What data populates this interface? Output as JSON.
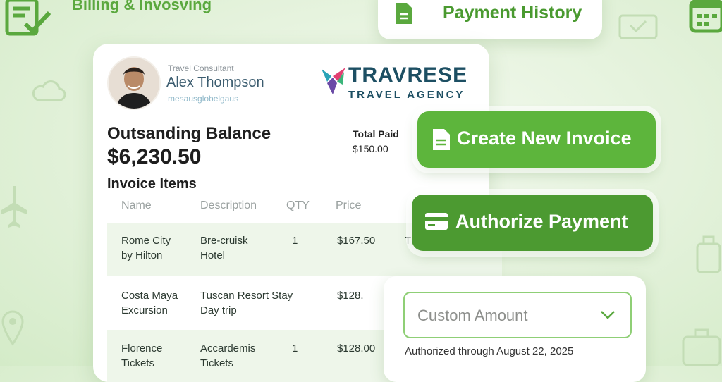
{
  "app": {
    "title": "Billing & Invosving"
  },
  "payment_history": {
    "label": "Payment History"
  },
  "consultant": {
    "role": "Travel Consultant",
    "name": "Alex Thompson",
    "email": "mesausglobelgaus"
  },
  "brand": {
    "name": "TRAVRESE",
    "tagline": "TRAVEL AGENCY"
  },
  "balance": {
    "label": "Outsanding Balance",
    "value": "$6,230.50"
  },
  "total_paid": {
    "label": "Total Paid",
    "value": "$150.00"
  },
  "invoice": {
    "title": "Invoice Items",
    "columns": [
      "Name",
      "Description",
      "QTY",
      "Price"
    ],
    "rows": [
      {
        "name_1": "Rome City",
        "name_2": "by Hilton",
        "desc_1": "Bre-cruisk",
        "desc_2": "Hotel",
        "qty": "1",
        "price": "$167.50",
        "extra": "T"
      },
      {
        "name_1": "Costa Maya",
        "name_2": "Excursion",
        "desc_1": "Tuscan Resort Stay",
        "desc_2": "Day trip",
        "qty": "",
        "price": "$128.",
        "extra": ""
      },
      {
        "name_1": "Florence",
        "name_2": "Tickets",
        "desc_1": "Accardemis",
        "desc_2": "Tickets",
        "qty": "1",
        "price": "$128.00",
        "extra": ""
      }
    ]
  },
  "actions": {
    "create_invoice": "Create New Invoice",
    "authorize_payment": "Authorize Payment"
  },
  "amount": {
    "placeholder": "Custom Amount",
    "authorized_note": "Authorized through August 22, 2025"
  },
  "colors": {
    "accent": "#5db53c",
    "accent_dark": "#4c9a31",
    "brand": "#1d4f63"
  },
  "icons": [
    "checklist-icon",
    "calendar-icon",
    "document-icon",
    "card-icon",
    "chevron-down-icon"
  ]
}
